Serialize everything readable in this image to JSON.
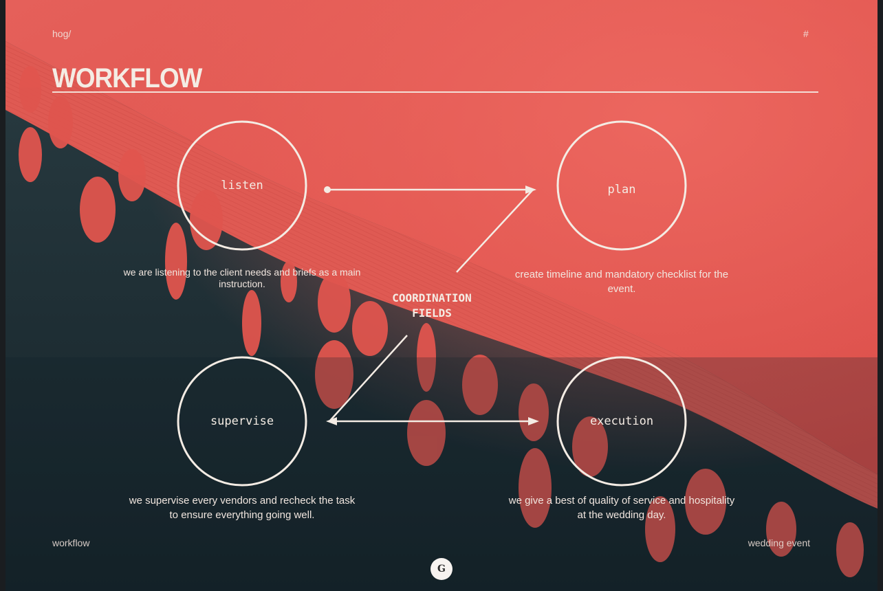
{
  "header": {
    "brand": "hog/",
    "page_marker": "#",
    "title": "WORKFLOW"
  },
  "diagram": {
    "center_line1": "COORDINATION",
    "center_line2": "FIELDS",
    "nodes": [
      {
        "label": "listen",
        "description": "we are listening to the client needs and briefs as a main instruction."
      },
      {
        "label": "plan",
        "description": "create timeline and mandatory checklist for the event."
      },
      {
        "label": "supervise",
        "description_line1": "we supervise every vendors and recheck the task",
        "description_line2": "to ensure everything going well."
      },
      {
        "label": "execution",
        "description_line1": "we give a best of quality of service and hospitality",
        "description_line2": "at the wedding day."
      }
    ]
  },
  "footer": {
    "left": "workflow",
    "right": "wedding event",
    "page_badge": "G"
  },
  "colors": {
    "coral": "#e2574f",
    "deep_teal": "#1c2f36",
    "cream": "#f4ece4"
  },
  "icons": {
    "page_badge": "monogram-badge-icon",
    "arrow": "arrow-right-icon"
  }
}
